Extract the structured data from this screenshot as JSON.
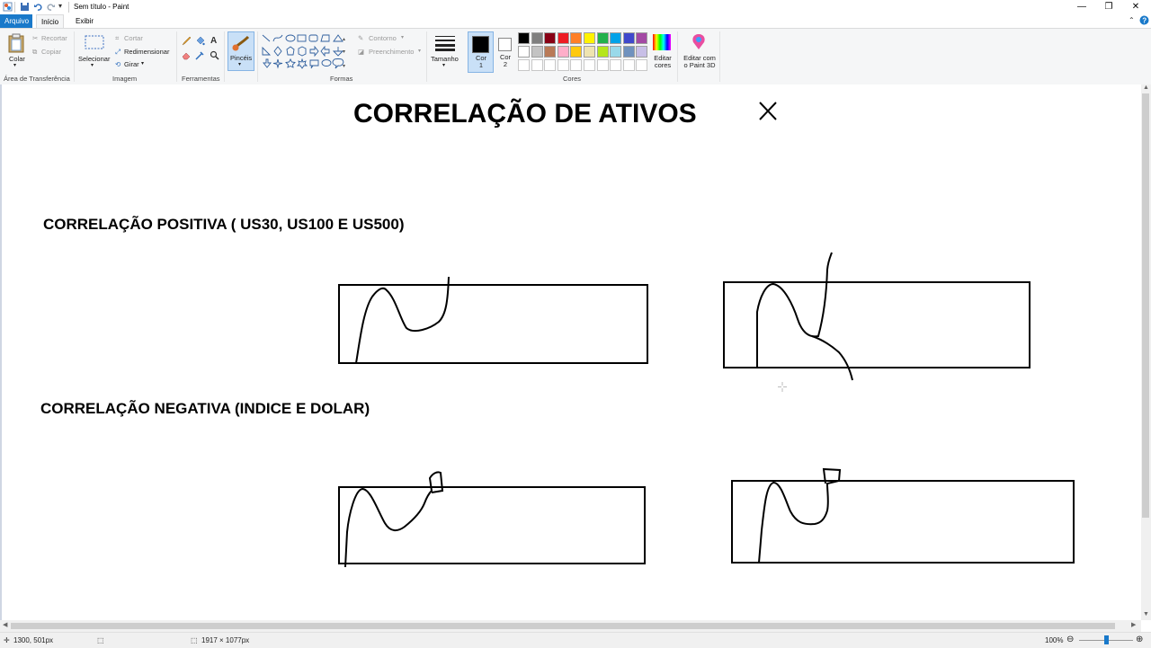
{
  "window": {
    "title": "Sem título - Paint"
  },
  "tabs": {
    "file": "Arquivo",
    "home": "Início",
    "view": "Exibir"
  },
  "ribbon": {
    "clipboard": {
      "paste": "Colar",
      "cut": "Recortar",
      "copy": "Copiar",
      "label": "Área de Transferência"
    },
    "image": {
      "select": "Selecionar",
      "crop": "Cortar",
      "resize": "Redimensionar",
      "rotate": "Girar",
      "label": "Imagem"
    },
    "tools": {
      "label": "Ferramentas"
    },
    "brushes": {
      "label": "Pincéis"
    },
    "shapes": {
      "outline": "Contorno",
      "fill": "Preenchimento",
      "label": "Formas"
    },
    "size": {
      "label": "Tamanho"
    },
    "color1": {
      "label": "Cor 1"
    },
    "color2": {
      "label": "Cor 2"
    },
    "colors": {
      "label": "Cores",
      "edit": "Editar cores"
    },
    "paint3d": {
      "label": "Editar com o Paint 3D"
    }
  },
  "palette": {
    "row1": [
      "#000000",
      "#7f7f7f",
      "#880015",
      "#ed1c24",
      "#ff7f27",
      "#fff200",
      "#22b14c",
      "#00a2e8",
      "#3f48cc",
      "#a349a4"
    ],
    "row2": [
      "#ffffff",
      "#c3c3c3",
      "#b97a57",
      "#ffaec9",
      "#ffc90e",
      "#efe4b0",
      "#b5e61d",
      "#99d9ea",
      "#7092be",
      "#c8bfe7"
    ],
    "row3": [
      "#ffffff",
      "#ffffff",
      "#ffffff",
      "#ffffff",
      "#ffffff",
      "#ffffff",
      "#ffffff",
      "#ffffff",
      "#ffffff",
      "#ffffff"
    ],
    "color1": "#000000",
    "color2": "#ffffff"
  },
  "canvas": {
    "title": "CORRELAÇÃO DE ATIVOS",
    "positive_heading": "CORRELAÇÃO POSITIVA ( US30, US100 E US500)",
    "negative_heading": "CORRELAÇÃO NEGATIVA (INDICE E DOLAR)"
  },
  "status": {
    "cursor": "1300, 501px",
    "size": "1917 × 1077px",
    "zoom": "100%"
  }
}
